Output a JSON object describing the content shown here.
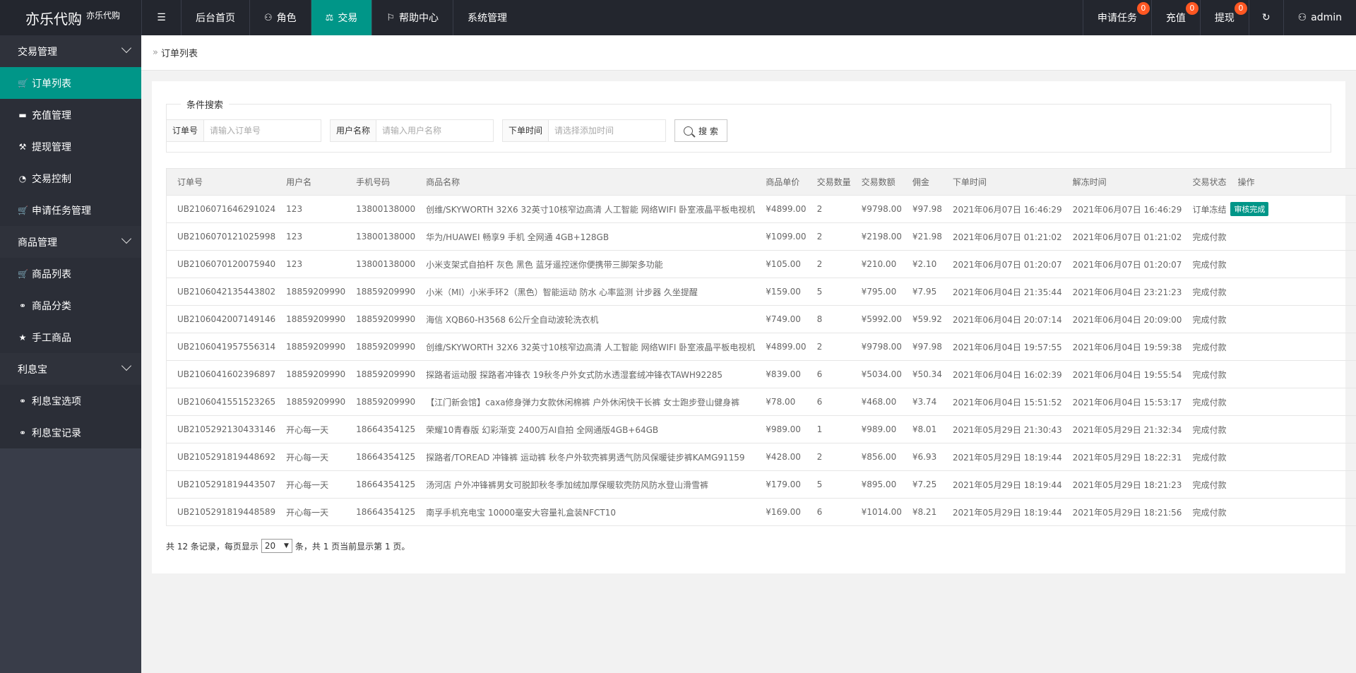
{
  "brand": {
    "title": "亦乐代购",
    "subtitle": "亦乐代购"
  },
  "topnav": [
    {
      "label": "后台首页",
      "icon": "",
      "active": false
    },
    {
      "label": "角色",
      "icon": "user-icon",
      "active": false
    },
    {
      "label": "交易",
      "icon": "scale-icon",
      "active": true
    },
    {
      "label": "帮助中心",
      "icon": "flag-icon",
      "active": false
    },
    {
      "label": "系统管理",
      "icon": "",
      "active": false
    }
  ],
  "topright": {
    "apply_task": {
      "label": "申请任务",
      "badge": "0"
    },
    "recharge": {
      "label": "充值",
      "badge": "0"
    },
    "withdraw": {
      "label": "提现",
      "badge": "0"
    },
    "user": "admin"
  },
  "sidebar": {
    "groups": [
      {
        "title": "交易管理",
        "items": [
          {
            "label": "订单列表",
            "icon": "cart-icon",
            "active": true
          },
          {
            "label": "充值管理",
            "icon": "chat-icon",
            "active": false
          },
          {
            "label": "提现管理",
            "icon": "hammer-icon",
            "active": false
          },
          {
            "label": "交易控制",
            "icon": "gauge-icon",
            "active": false
          },
          {
            "label": "申请任务管理",
            "icon": "cart-icon",
            "active": false
          }
        ]
      },
      {
        "title": "商品管理",
        "items": [
          {
            "label": "商品列表",
            "icon": "cart-icon",
            "active": false
          },
          {
            "label": "商品分类",
            "icon": "link-icon",
            "active": false
          },
          {
            "label": "手工商品",
            "icon": "star-icon",
            "active": false
          }
        ]
      },
      {
        "title": "利息宝",
        "items": [
          {
            "label": "利息宝选项",
            "icon": "link-icon",
            "active": false
          },
          {
            "label": "利息宝记录",
            "icon": "link-icon",
            "active": false
          }
        ]
      }
    ]
  },
  "breadcrumb": "订单列表",
  "search": {
    "legend": "条件搜索",
    "order_label": "订单号",
    "order_placeholder": "请输入订单号",
    "user_label": "用户名称",
    "user_placeholder": "请输入用户名称",
    "time_label": "下单时间",
    "time_placeholder": "请选择添加时间",
    "button": "搜 索"
  },
  "table": {
    "headers": [
      "订单号",
      "用户名",
      "手机号码",
      "商品名称",
      "商品单价",
      "交易数量",
      "交易数额",
      "佣金",
      "下单时间",
      "解冻时间",
      "交易状态",
      "操作"
    ],
    "rows": [
      [
        "UB2106071646291024",
        "123",
        "13800138000",
        "创维/SKYWORTH 32X6 32英寸10核窄边高清 人工智能 网络WIFI 卧室液晶平板电视机",
        "¥4899.00",
        "2",
        "¥9798.00",
        "¥97.98",
        "2021年06月07日 16:46:29",
        "2021年06月07日 16:46:29",
        "订单冻结",
        "审核完成"
      ],
      [
        "UB2106070121025998",
        "123",
        "13800138000",
        "华为/HUAWEI 畅享9 手机 全网通 4GB+128GB",
        "¥1099.00",
        "2",
        "¥2198.00",
        "¥21.98",
        "2021年06月07日 01:21:02",
        "2021年06月07日 01:21:02",
        "完成付款",
        ""
      ],
      [
        "UB2106070120075940",
        "123",
        "13800138000",
        "小米支架式自拍杆 灰色 黑色 蓝牙遥控迷你便携带三脚架多功能",
        "¥105.00",
        "2",
        "¥210.00",
        "¥2.10",
        "2021年06月07日 01:20:07",
        "2021年06月07日 01:20:07",
        "完成付款",
        ""
      ],
      [
        "UB2106042135443802",
        "18859209990",
        "18859209990",
        "小米（MI）小米手环2（黑色）智能运动 防水 心率监测 计步器 久坐提醒",
        "¥159.00",
        "5",
        "¥795.00",
        "¥7.95",
        "2021年06月04日 21:35:44",
        "2021年06月04日 23:21:23",
        "完成付款",
        ""
      ],
      [
        "UB2106042007149146",
        "18859209990",
        "18859209990",
        "海信 XQB60-H3568 6公斤全自动波轮洗衣机",
        "¥749.00",
        "8",
        "¥5992.00",
        "¥59.92",
        "2021年06月04日 20:07:14",
        "2021年06月04日 20:09:00",
        "完成付款",
        ""
      ],
      [
        "UB2106041957556314",
        "18859209990",
        "18859209990",
        "创维/SKYWORTH 32X6 32英寸10核窄边高清 人工智能 网络WIFI 卧室液晶平板电视机",
        "¥4899.00",
        "2",
        "¥9798.00",
        "¥97.98",
        "2021年06月04日 19:57:55",
        "2021年06月04日 19:59:38",
        "完成付款",
        ""
      ],
      [
        "UB2106041602396897",
        "18859209990",
        "18859209990",
        "探路者运动服 探路者冲锋衣 19秋冬户外女式防水透湿套绒冲锋衣TAWH92285",
        "¥839.00",
        "6",
        "¥5034.00",
        "¥50.34",
        "2021年06月04日 16:02:39",
        "2021年06月04日 19:55:54",
        "完成付款",
        ""
      ],
      [
        "UB2106041551523265",
        "18859209990",
        "18859209990",
        "【江门新会馆】caxa修身弹力女款休闲棉裤 户外休闲快干长裤 女士跑步登山健身裤",
        "¥78.00",
        "6",
        "¥468.00",
        "¥3.74",
        "2021年06月04日 15:51:52",
        "2021年06月04日 15:53:17",
        "完成付款",
        ""
      ],
      [
        "UB2105292130433146",
        "开心每一天",
        "18664354125",
        "荣耀10青春版 幻彩渐变 2400万AI自拍 全网通版4GB+64GB",
        "¥989.00",
        "1",
        "¥989.00",
        "¥8.01",
        "2021年05月29日 21:30:43",
        "2021年05月29日 21:32:34",
        "完成付款",
        ""
      ],
      [
        "UB2105291819448692",
        "开心每一天",
        "18664354125",
        "探路者/TOREAD 冲锋裤 运动裤 秋冬户外软壳裤男透气防风保暖徒步裤KAMG91159",
        "¥428.00",
        "2",
        "¥856.00",
        "¥6.93",
        "2021年05月29日 18:19:44",
        "2021年05月29日 18:22:31",
        "完成付款",
        ""
      ],
      [
        "UB2105291819443507",
        "开心每一天",
        "18664354125",
        "汤河店 户外冲锋裤男女可脱卸秋冬季加绒加厚保暖软壳防风防水登山滑雪裤",
        "¥179.00",
        "5",
        "¥895.00",
        "¥7.25",
        "2021年05月29日 18:19:44",
        "2021年05月29日 18:21:23",
        "完成付款",
        ""
      ],
      [
        "UB2105291819448589",
        "开心每一天",
        "18664354125",
        "南孚手机充电宝 10000毫安大容量礼盒装NFCT10",
        "¥169.00",
        "6",
        "¥1014.00",
        "¥8.21",
        "2021年05月29日 18:19:44",
        "2021年05月29日 18:21:56",
        "完成付款",
        ""
      ]
    ]
  },
  "pager": {
    "prefix": "共 12 条记录，每页显示",
    "page_size": "20",
    "suffix": "条，共 1 页当前显示第 1 页。"
  }
}
